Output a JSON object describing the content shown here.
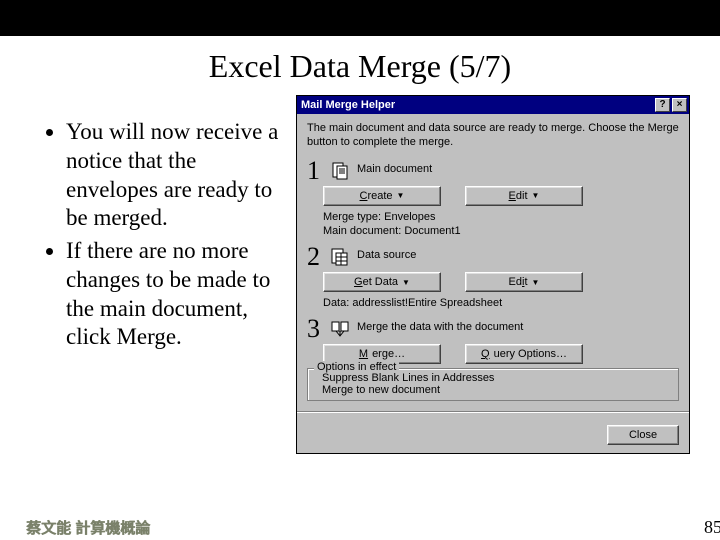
{
  "slide": {
    "title": "Excel Data Merge (5/7)",
    "bullets": [
      "You will now receive a notice that the envelopes are ready to be merged.",
      "If there are no more changes to be made to the main document, click Merge."
    ],
    "footer_author": "蔡文能 計算機概論",
    "page_number": "85"
  },
  "dialog": {
    "title": "Mail Merge Helper",
    "help_btn": "?",
    "close_btn": "×",
    "instruction": "The main document and data source are ready to merge. Choose the Merge button to complete the merge.",
    "step1": {
      "num": "1",
      "label": "Main document",
      "create_btn": "Create",
      "edit_btn": "Edit",
      "info": "Merge type: Envelopes\nMain document: Document1"
    },
    "step2": {
      "num": "2",
      "label": "Data source",
      "getdata_btn": "Get Data",
      "edit_btn": "Edit",
      "info": "Data: addresslist!Entire Spreadsheet"
    },
    "step3": {
      "num": "3",
      "label": "Merge the data with the document",
      "merge_btn": "Merge…",
      "query_btn": "Query Options…",
      "options_legend": "Options in effect",
      "options": [
        "Suppress Blank Lines in Addresses",
        "Merge to new document"
      ]
    },
    "close_label": "Close"
  }
}
